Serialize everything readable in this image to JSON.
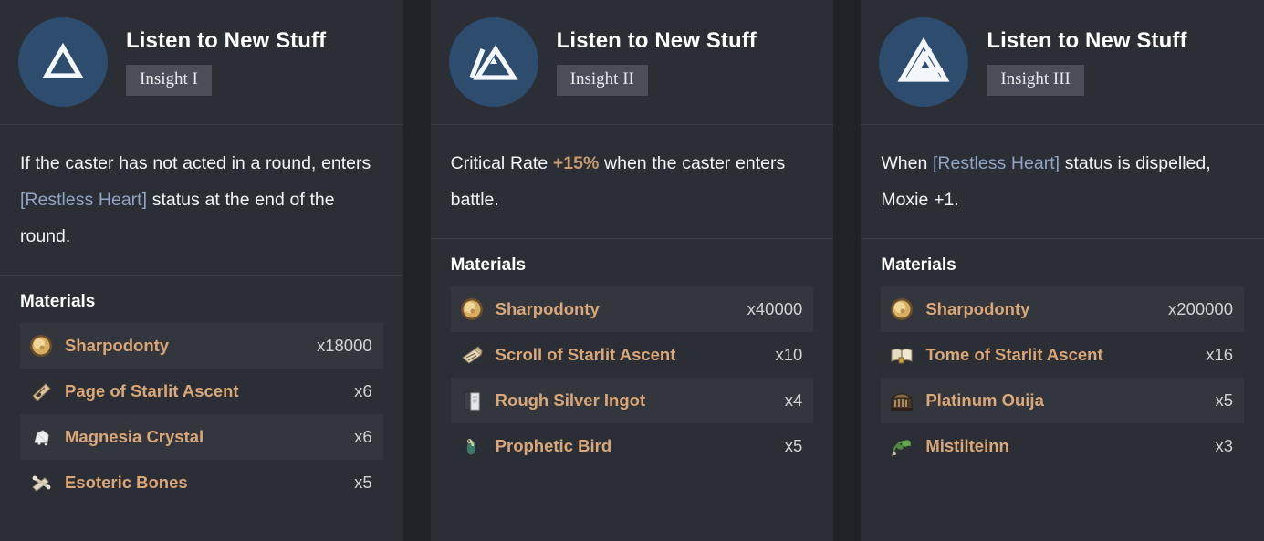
{
  "theme": {
    "page_background": "#202227",
    "panel_background": "#2b2e34",
    "row_highlight": "#33363d",
    "emblem_background": "#2d4c6e",
    "badge_background": "#4b4e58",
    "material_name_color": "#d9a778",
    "status_text_color": "#8fa4c4",
    "buff_text_color": "#c69a6e",
    "divider_color": "#3a3d44"
  },
  "panels": [
    {
      "emblem_icon": "one-triangle-icon",
      "title": "Listen to New Stuff",
      "insight_label": "Insight I",
      "description": {
        "parts": [
          {
            "text": "If the caster has not acted in a round, enters ",
            "style": "normal"
          },
          {
            "text": "[Restless Heart]",
            "style": "status"
          },
          {
            "text": " status at the end of the round.",
            "style": "normal"
          }
        ]
      },
      "materials_heading": "Materials",
      "materials": [
        {
          "icon": "gold-coin-icon",
          "name": "Sharpodonty",
          "qty": "x18000"
        },
        {
          "icon": "page-scroll-icon",
          "name": "Page of Starlit Ascent",
          "qty": "x6"
        },
        {
          "icon": "white-crystal-icon",
          "name": "Magnesia Crystal",
          "qty": "x6"
        },
        {
          "icon": "bones-icon",
          "name": "Esoteric Bones",
          "qty": "x5"
        }
      ]
    },
    {
      "emblem_icon": "two-triangle-icon",
      "title": "Listen to New Stuff",
      "insight_label": "Insight II",
      "description": {
        "parts": [
          {
            "text": "Critical Rate ",
            "style": "normal"
          },
          {
            "text": "+15%",
            "style": "buff"
          },
          {
            "text": " when the caster enters battle.",
            "style": "normal"
          }
        ]
      },
      "materials_heading": "Materials",
      "materials": [
        {
          "icon": "gold-coin-icon",
          "name": "Sharpodonty",
          "qty": "x40000"
        },
        {
          "icon": "scroll-icon",
          "name": "Scroll of Starlit Ascent",
          "qty": "x10"
        },
        {
          "icon": "silver-ingot-icon",
          "name": "Rough Silver Ingot",
          "qty": "x4"
        },
        {
          "icon": "bird-icon",
          "name": "Prophetic Bird",
          "qty": "x5"
        }
      ]
    },
    {
      "emblem_icon": "three-triangle-icon",
      "title": "Listen to New Stuff",
      "insight_label": "Insight III",
      "description": {
        "parts": [
          {
            "text": "When ",
            "style": "normal"
          },
          {
            "text": "[Restless Heart]",
            "style": "status"
          },
          {
            "text": " status is dispelled, Moxie +1.",
            "style": "normal"
          }
        ]
      },
      "materials_heading": "Materials",
      "materials": [
        {
          "icon": "gold-coin-icon",
          "name": "Sharpodonty",
          "qty": "x200000"
        },
        {
          "icon": "tome-icon",
          "name": "Tome of Starlit Ascent",
          "qty": "x16"
        },
        {
          "icon": "ouija-icon",
          "name": "Platinum Ouija",
          "qty": "x5"
        },
        {
          "icon": "mistletoe-icon",
          "name": "Mistilteinn",
          "qty": "x3"
        }
      ]
    }
  ]
}
